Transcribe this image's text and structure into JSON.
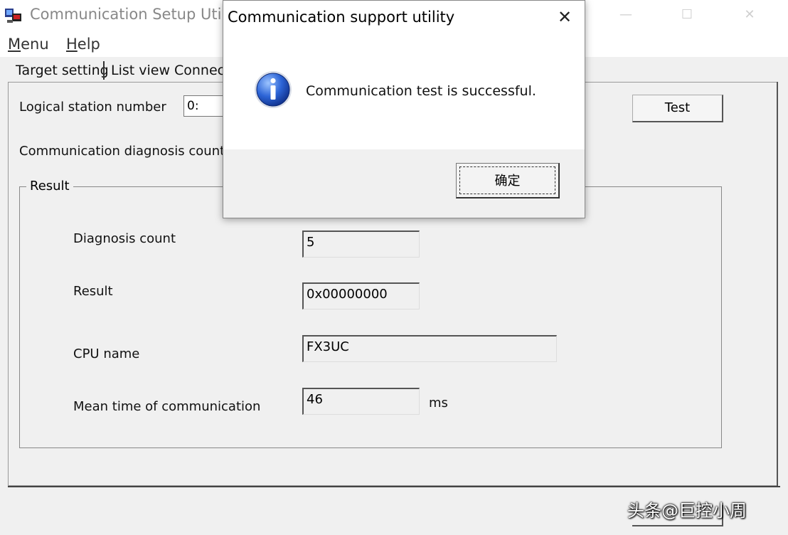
{
  "main_window": {
    "title": "Communication Setup Uti",
    "controls": {
      "minimize": "—",
      "maximize": "☐",
      "close": "✕"
    }
  },
  "menu": {
    "menu_first": "M",
    "menu_rest": "enu",
    "help_first": "H",
    "help_rest": "elp"
  },
  "tabs": {
    "target": "Target setting",
    "list": "List view",
    "connect": "Connect"
  },
  "form": {
    "station_label": "Logical station number",
    "station_value": "0:",
    "diag_count_label": "Communication diagnosis count",
    "test_button": "Test"
  },
  "result": {
    "legend": "Result",
    "diag_label": "Diagnosis count",
    "diag_value": "5",
    "result_label": "Result",
    "result_value": "0x00000000",
    "cpu_label": "CPU name",
    "cpu_value": "FX3UC",
    "mean_label": "Mean time of communication",
    "mean_value": "46",
    "mean_unit": "ms"
  },
  "dialog": {
    "title": "Communication support utility",
    "close": "✕",
    "message": "Communication test is successful.",
    "ok": "确定",
    "icon": "info-icon"
  },
  "watermark": "头条@巨控小周"
}
